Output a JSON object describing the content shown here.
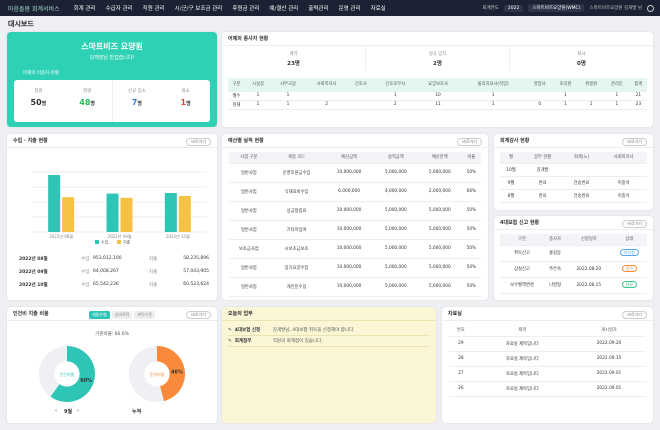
{
  "brand": "마음돌봄 회계서비스",
  "menu": [
    "회계 관리",
    "수급자 관리",
    "직원 관리",
    "시/군/구 보조금 관리",
    "후원금 관리",
    "예/결산 관리",
    "출력관리",
    "운영 관리",
    "자료실"
  ],
  "topright": {
    "year_label": "회계연도",
    "year": "2022",
    "org1": "스마트비즈요양원(WMC)",
    "org2": "스마트비즈요양원 김개발 님"
  },
  "page_title": "대시보드",
  "welcome": {
    "name": "스마트비즈 요양원",
    "greeting": "김개발님 반갑습니다!",
    "section": "어제의 이용자 현황",
    "stats": [
      {
        "label": "정원",
        "value": "50",
        "unit": "명"
      },
      {
        "label": "현원",
        "value": "48",
        "unit": "명"
      },
      {
        "label": "신규 입소",
        "value": "7",
        "unit": "명"
      },
      {
        "label": "퇴소",
        "value": "1",
        "unit": "명"
      }
    ]
  },
  "staff": {
    "title": "어제의 종사자 현황",
    "summary": [
      {
        "label": "계약",
        "value": "23명"
      },
      {
        "label": "정규 임직",
        "value": "2명"
      },
      {
        "label": "퇴사",
        "value": "0명"
      }
    ],
    "headers": [
      "구분",
      "시설장",
      "사무국장",
      "사회복지사",
      "간호사",
      "간호조무사",
      "요양보호사",
      "물리치료사(작업)",
      "영양사",
      "조리원",
      "위생원",
      "관리인",
      "합계"
    ],
    "rows": [
      [
        "월수",
        "1",
        "1",
        "",
        "",
        "1",
        "10",
        "1",
        "",
        "1",
        "",
        "1",
        "21"
      ],
      [
        "현재",
        "1",
        "1",
        "2",
        "",
        "2",
        "11",
        "1",
        "0",
        "1",
        "1",
        "1",
        "23"
      ]
    ]
  },
  "finance": {
    "title": "수입 · 지출 현황",
    "more": "바로가기",
    "legend_income": "수입",
    "legend_expense": "지출",
    "months": [
      "2022년 08월",
      "2022년 09월",
      "2022년 10월"
    ],
    "rows": [
      {
        "month": "2022년 08월",
        "inc_label": "수입",
        "inc": "953,012,100",
        "exp_label": "지출",
        "exp": "58,235,896"
      },
      {
        "month": "2022년 09월",
        "inc_label": "수입",
        "inc": "64,008,267",
        "exp_label": "지출",
        "exp": "57,043,905"
      },
      {
        "month": "2022년 10월",
        "inc_label": "수입",
        "inc": "65,542,236",
        "exp_label": "지출",
        "exp": "60,523,624"
      }
    ]
  },
  "budget": {
    "title": "예산별 실적 현황",
    "more": "바로가기",
    "headers": [
      "사업 구분",
      "계정 코드",
      "예산금액",
      "실적금액",
      "예산잔액",
      "비율"
    ],
    "rows": [
      [
        "일반사업",
        "운영후원금수입",
        "10,000,000",
        "5,000,000",
        "5,000,000",
        "50%"
      ],
      [
        "일반사업",
        "식재료비수입",
        "6,000,000",
        "4,000,000",
        "2,000,000",
        "66%"
      ],
      [
        "일반사업",
        "상금정립료",
        "10,000,000",
        "5,000,000",
        "5,000,000",
        "50%"
      ],
      [
        "일반사업",
        "기타이입여",
        "10,000,000",
        "5,000,000",
        "5,000,000",
        "50%"
      ],
      [
        "보조금사업",
        "시보조금보조",
        "10,000,000",
        "5,000,000",
        "5,000,000",
        "50%"
      ],
      [
        "일반사업",
        "장기요양수입",
        "10,000,000",
        "5,000,000",
        "5,000,000",
        "50%"
      ],
      [
        "일반사업",
        "개인분수입",
        "10,000,000",
        "5,000,000",
        "5,000,000",
        "50%"
      ]
    ]
  },
  "audit": {
    "title": "회계감사 현황",
    "more": "바로가기",
    "headers": [
      "월",
      "장부 현황",
      "회계(노)",
      "사회복지사"
    ],
    "rows": [
      [
        "10월",
        "김개발",
        "",
        ""
      ],
      [
        "9월",
        "완료",
        "전송완료",
        "이중석"
      ],
      [
        "8월",
        "완료",
        "전송완료",
        "이중석"
      ]
    ]
  },
  "insurance": {
    "title": "4대보험 신고 현황",
    "more": "바로가기",
    "headers": [
      "구분",
      "종사자",
      "신청일자",
      "상태"
    ],
    "rows": [
      {
        "type": "취득신고",
        "name": "홍길동",
        "date": "",
        "status": "미신청",
        "color": "#5aa9e6"
      },
      {
        "type": "상실신고",
        "name": "주은숙",
        "date": "2022.08.20",
        "status": "접수",
        "color": "#f28c38"
      },
      {
        "type": "보수월액변경",
        "name": "나영형",
        "date": "2022.08.15",
        "status": "완료",
        "color": "#3cc48f"
      }
    ]
  },
  "ratio": {
    "title": "인건비 지출 비율",
    "more": "바로가기",
    "tabs": [
      "재원유형",
      "성과목적",
      "위탁기준"
    ],
    "base": "기준비율: 66.6%",
    "pie1": {
      "label": "인건비율",
      "pct": 60,
      "pct_text": "60%",
      "color": "#2ec4b6"
    },
    "pie2": {
      "label": "운영비율",
      "pct": 46,
      "pct_text": "46%",
      "color": "#f98a3c"
    },
    "month_label": "9월",
    "cumulative": "누적"
  },
  "tasks": {
    "title": "오늘의 업무",
    "items": [
      {
        "tag": "4대보험 신청",
        "text": "김개발님, 4대보험 취득을 신청해야 합니다."
      },
      {
        "tag": "회계점무",
        "text": "직원의 회계점이 있습니다."
      }
    ]
  },
  "files": {
    "title": "자료실",
    "more": "바로가기",
    "headers": [
      "번호",
      "제목",
      "게시일자"
    ],
    "rows": [
      [
        "29",
        "자료실 제목입니다",
        "2022.09.20"
      ],
      [
        "28",
        "자료실 제목입니다",
        "2022.09.15"
      ],
      [
        "27",
        "자료실 제목입니다",
        "2022.09.01"
      ],
      [
        "26",
        "자료실 제목입니다",
        "2022.09.01"
      ]
    ]
  },
  "chart_data": {
    "type": "bar",
    "categories": [
      "2022년 08월",
      "2022년 09월",
      "2022년 10월"
    ],
    "series": [
      {
        "name": "수입",
        "values": [
          95,
          64,
          65
        ]
      },
      {
        "name": "지출",
        "values": [
          58,
          57,
          60
        ]
      }
    ],
    "ylim": [
      0,
      100
    ],
    "colors": [
      "#2ec4b6",
      "#f6c244"
    ]
  }
}
